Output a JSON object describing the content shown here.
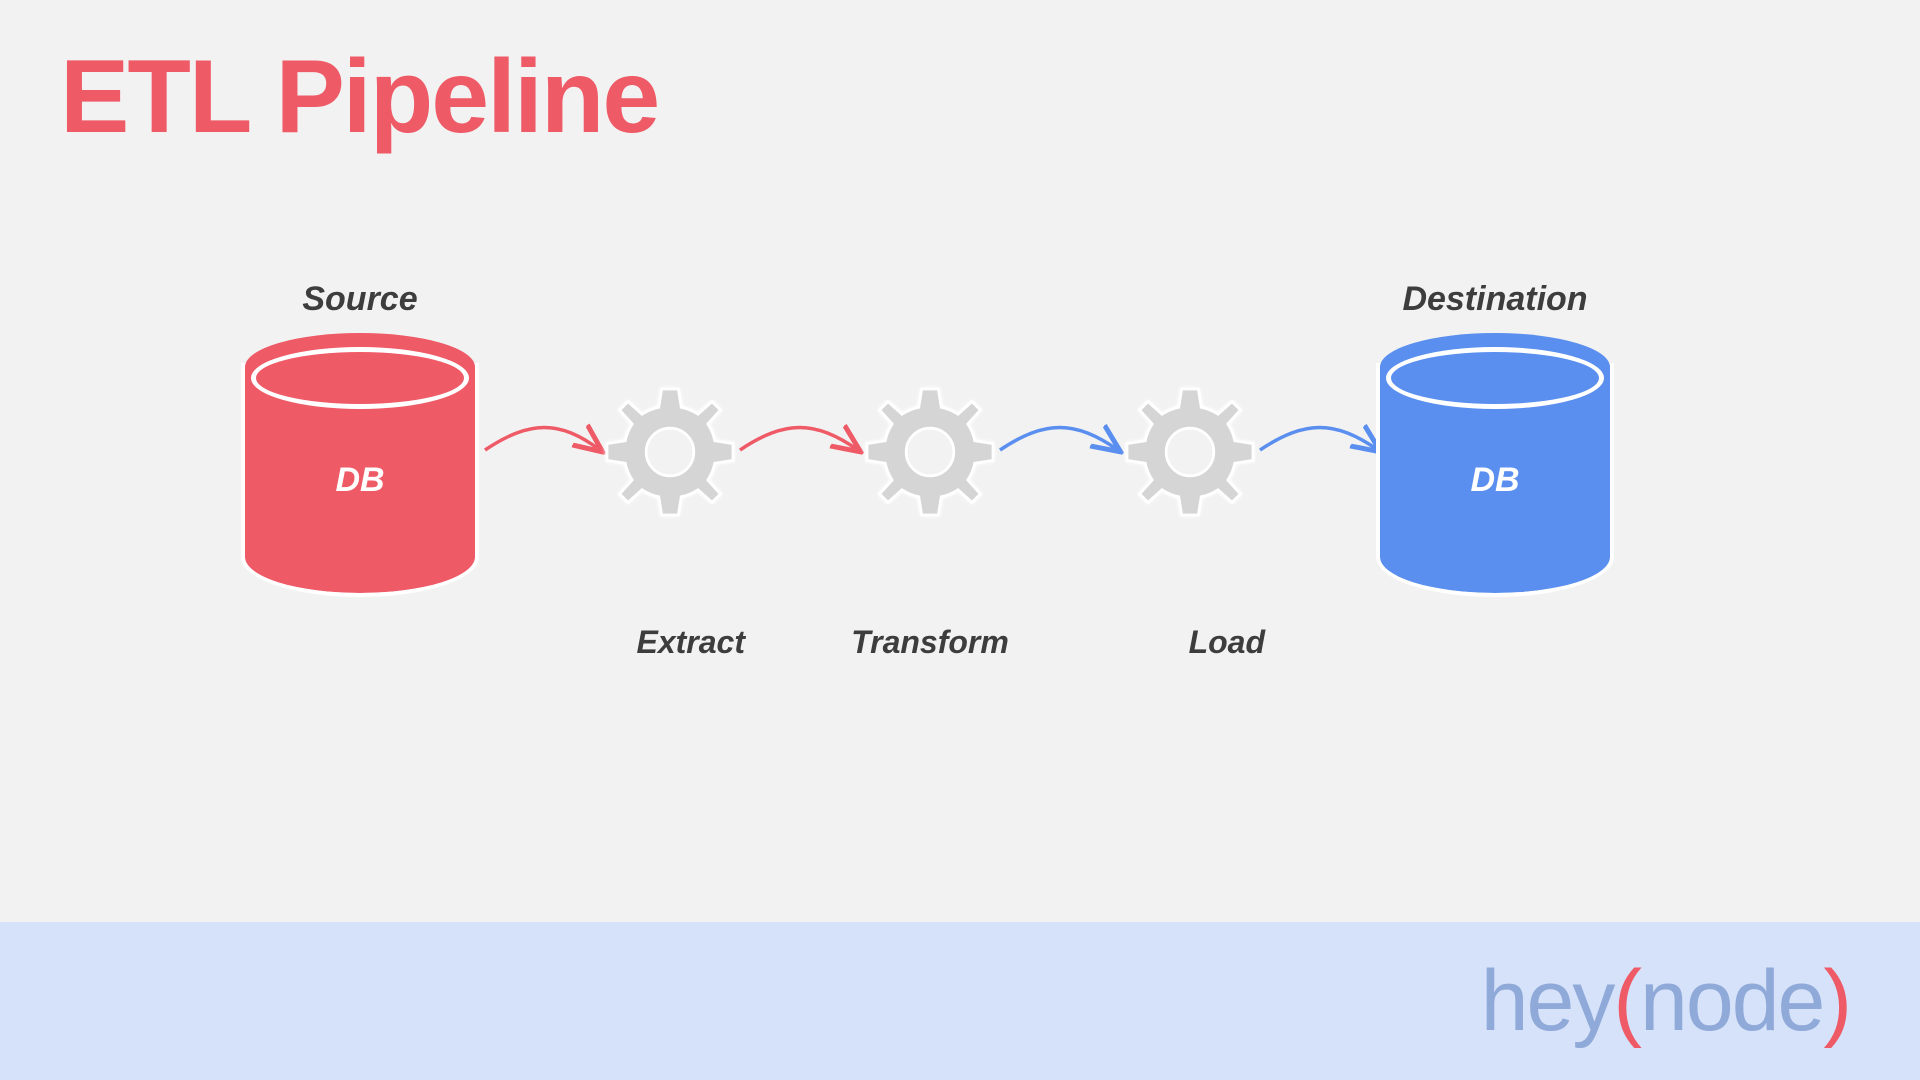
{
  "title": "ETL Pipeline",
  "source": {
    "label": "Source",
    "db_text": "DB"
  },
  "destination": {
    "label": "Destination",
    "db_text": "DB"
  },
  "steps": {
    "extract": "Extract",
    "transform": "Transform",
    "load": "Load"
  },
  "brand": {
    "hey": "hey",
    "open": "(",
    "node": "node",
    "close": ")"
  },
  "colors": {
    "red": "#ef5a67",
    "blue": "#5a8fef",
    "grey": "#d5d5d5",
    "footer": "#d6e2f9",
    "brand_blue": "#8fa9d9"
  }
}
